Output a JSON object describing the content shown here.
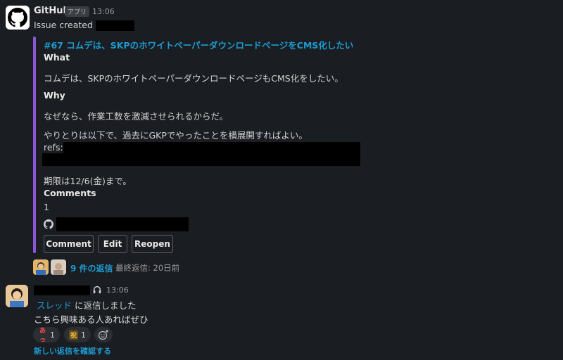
{
  "message": {
    "app_name": "GitHub",
    "app_badge": "アプリ",
    "time": "13:06",
    "intro": "Issue created by"
  },
  "issue": {
    "title": "#67 コムデは、SKPのホワイトペーパーダウンロードページをCMS化したい",
    "what_heading": "What",
    "what_body": "コムデは、SKPのホワイトペーパーダウンロードページもCMS化をしたい。",
    "why_heading": "Why",
    "why_body_1": "なぜなら、作業工数を激減させられるからだ。",
    "why_body_2": "やりとりは以下で、過去にGKPでやったことを横展開すればよい。",
    "refs_label": "refs:",
    "deadline": "期限は12/6(金)まで。",
    "comments_heading": "Comments",
    "comments_value": "1"
  },
  "buttons": {
    "comment": "Comment",
    "edit": "Edit",
    "reopen": "Reopen"
  },
  "thread_summary": {
    "replies": "9 件の返信",
    "last_reply": "最終返信: 20日前"
  },
  "reply": {
    "time": "13:06",
    "thread_link": "スレッド",
    "thread_suffix": " に返信しました",
    "text": "こちら興味ある人あればぜひ",
    "reactions": [
      {
        "emoji_label": "あっ",
        "count": "1"
      },
      {
        "emoji_label": "祝",
        "count": "1"
      }
    ],
    "new_replies": "新しい返信を確認する"
  },
  "colors": {
    "background": "#1a1d21",
    "link": "#1d9bd1",
    "attachment_bar": "#8c56d8"
  },
  "icons": [
    "github-icon",
    "headphones-icon",
    "add-reaction-icon"
  ]
}
